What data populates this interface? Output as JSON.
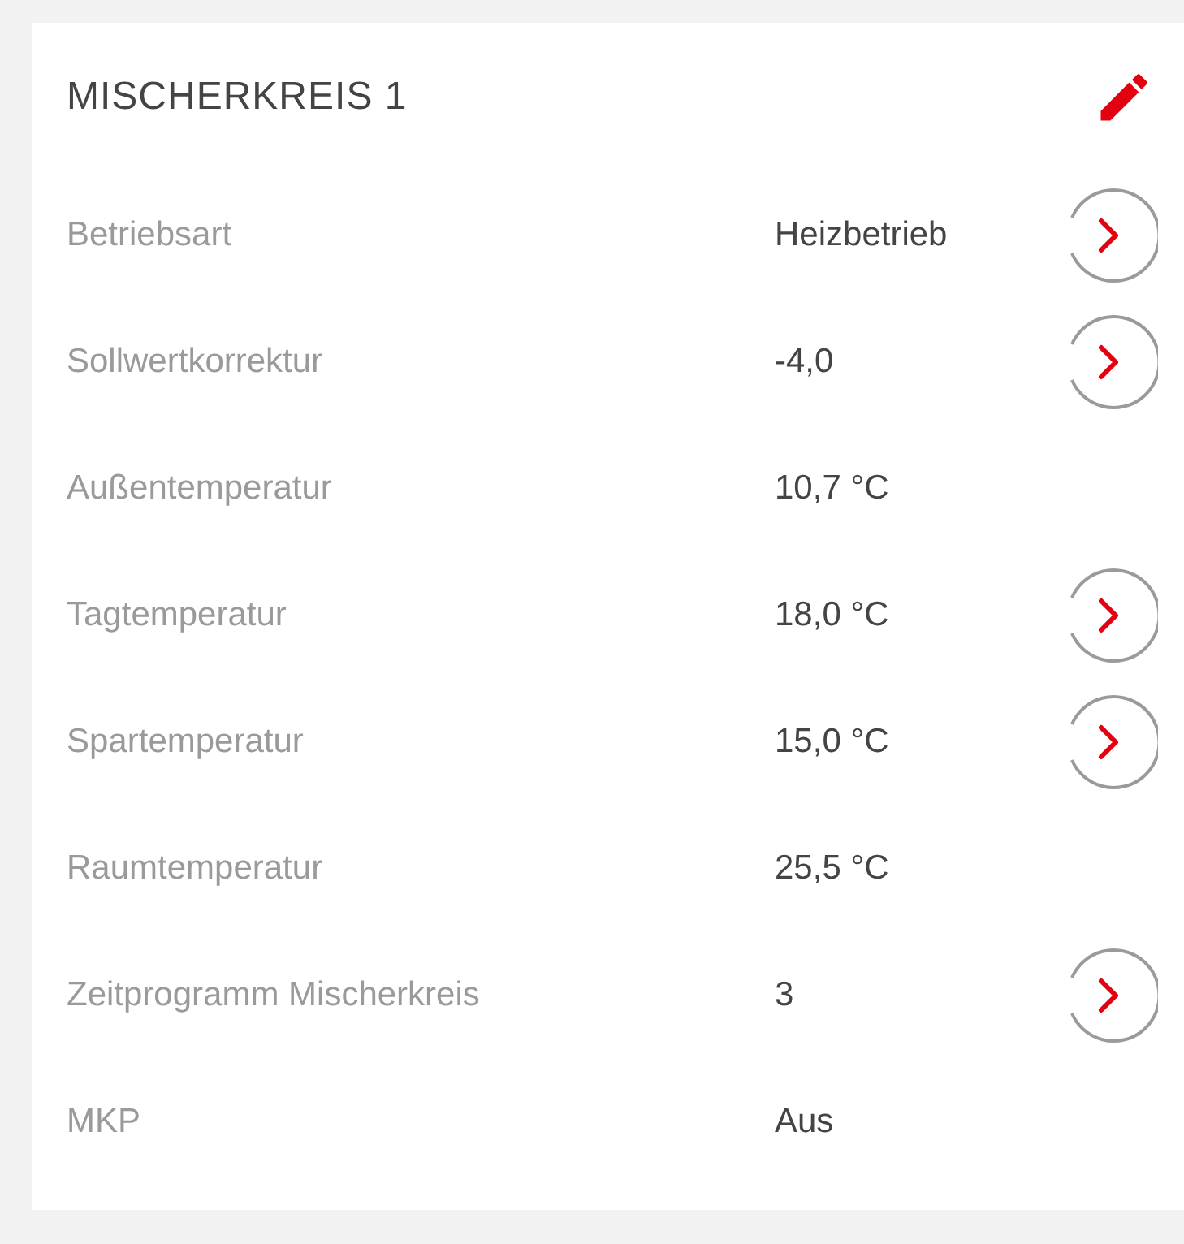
{
  "card": {
    "title": "MISCHERKREIS 1",
    "rows": [
      {
        "label": "Betriebsart",
        "value": "Heizbetrieb",
        "action": true
      },
      {
        "label": "Sollwertkorrektur",
        "value": "-4,0",
        "action": true
      },
      {
        "label": "Außentemperatur",
        "value": "10,7 °C",
        "action": false
      },
      {
        "label": "Tagtemperatur",
        "value": "18,0 °C",
        "action": true
      },
      {
        "label": "Spartemperatur",
        "value": "15,0 °C",
        "action": true
      },
      {
        "label": "Raumtemperatur",
        "value": "25,5 °C",
        "action": false
      },
      {
        "label": "Zeitprogramm Mischerkreis",
        "value": "3",
        "action": true
      },
      {
        "label": "MKP",
        "value": "Aus",
        "action": false
      }
    ]
  }
}
